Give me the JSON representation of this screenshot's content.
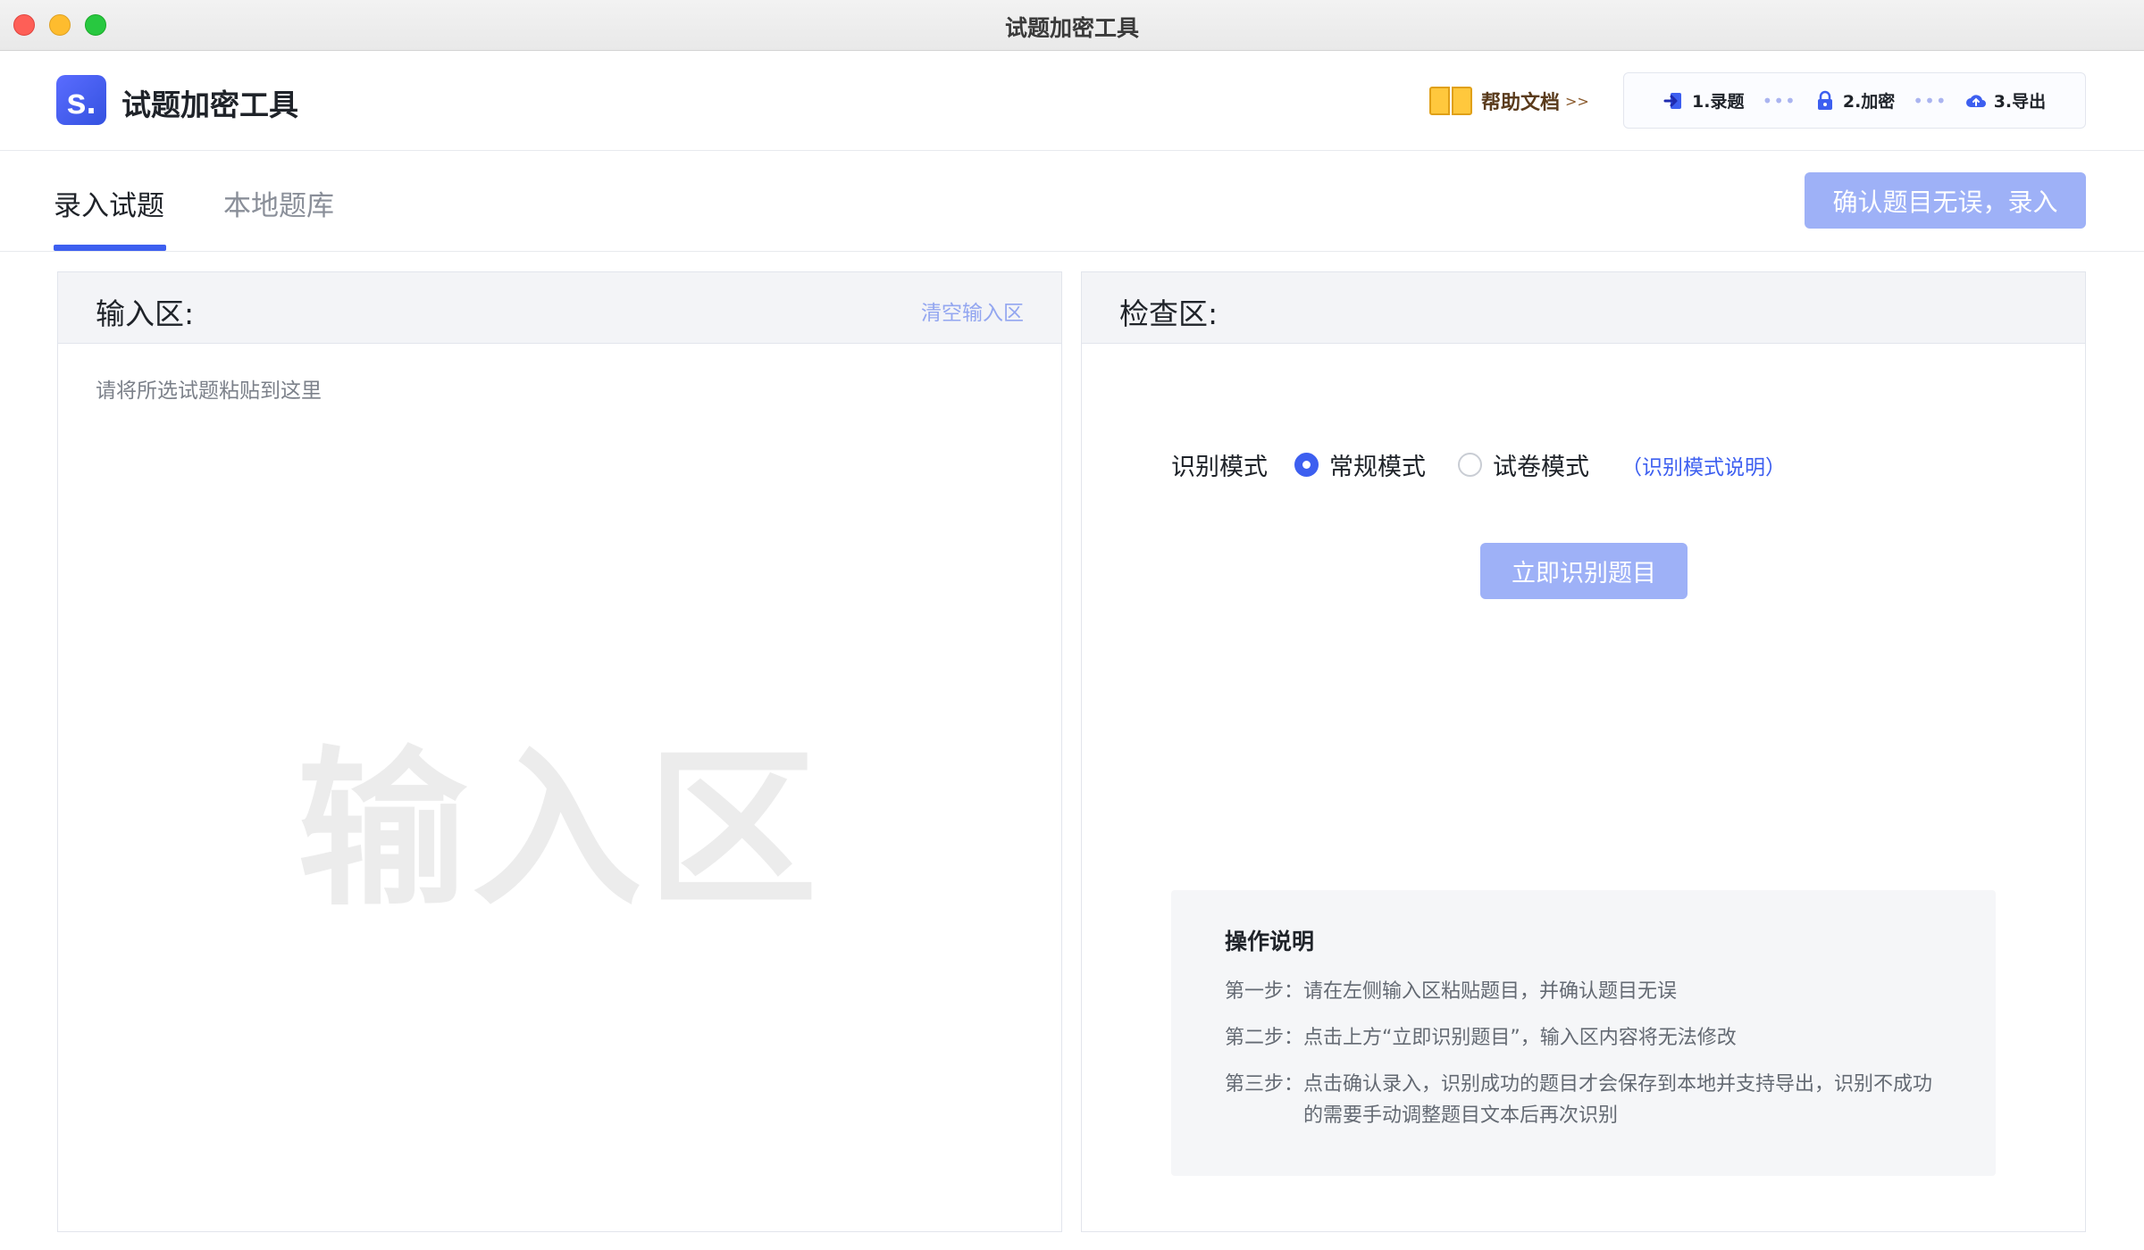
{
  "window": {
    "title": "试题加密工具"
  },
  "header": {
    "app_name": "试题加密工具",
    "logo_letter": "s.",
    "help_label": "帮助文档",
    "help_arrow": ">>",
    "steps": [
      {
        "label": "1.录题",
        "icon": "login-arrow-icon"
      },
      {
        "label": "2.加密",
        "icon": "lock-icon"
      },
      {
        "label": "3.导出",
        "icon": "cloud-upload-icon"
      }
    ],
    "step_separator": "•••"
  },
  "tabs": {
    "items": [
      {
        "label": "录入试题",
        "active": true
      },
      {
        "label": "本地题库",
        "active": false
      }
    ],
    "confirm_button": "确认题目无误，录入"
  },
  "input_panel": {
    "title": "输入区:",
    "clear_link": "清空输入区",
    "placeholder": "请将所选试题粘贴到这里",
    "watermark": "输入区"
  },
  "check_panel": {
    "title": "检查区:",
    "mode_label": "识别模式",
    "modes": [
      {
        "label": "常规模式",
        "selected": true
      },
      {
        "label": "试卷模式",
        "selected": false
      }
    ],
    "mode_help": "（识别模式说明）",
    "recognize_button": "立即识别题目",
    "instructions": {
      "title": "操作说明",
      "steps": [
        {
          "label": "第一步：",
          "text": "请在左侧输入区粘贴题目，并确认题目无误"
        },
        {
          "label": "第二步：",
          "text": "点击上方“立即识别题目”，输入区内容将无法修改"
        },
        {
          "label": "第三步：",
          "text": "点击确认录入，识别成功的题目才会保存到本地并支持导出，识别不成功的需要手动调整题目文本后再次识别"
        }
      ]
    }
  },
  "colors": {
    "accent": "#3d5ff0",
    "disabled_button": "#9eb1f7",
    "panel_header": "#f3f4f7"
  }
}
